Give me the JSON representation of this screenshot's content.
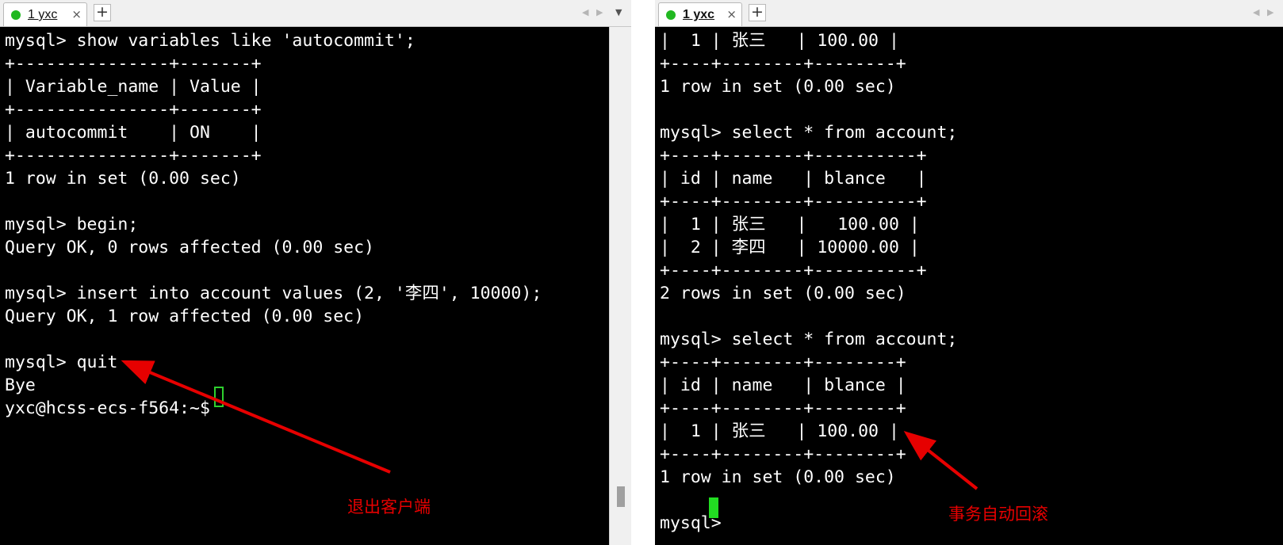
{
  "left_window": {
    "tab": {
      "title": "1 yxc",
      "close": "×"
    },
    "add_tab": "+",
    "nav": {
      "prev": "◀",
      "next": "▶",
      "menu": "▼"
    },
    "lines": [
      "mysql> show variables like 'autocommit';",
      "+---------------+-------+",
      "| Variable_name | Value |",
      "+---------------+-------+",
      "| autocommit    | ON    |",
      "+---------------+-------+",
      "1 row in set (0.00 sec)",
      "",
      "mysql> begin;",
      "Query OK, 0 rows affected (0.00 sec)",
      "",
      "mysql> insert into account values (2, '李四', 10000);",
      "Query OK, 1 row affected (0.00 sec)",
      "",
      "mysql> quit",
      "Bye",
      "yxc@hcss-ecs-f564:~$ "
    ],
    "annotation": "退出客户端"
  },
  "right_window": {
    "tab": {
      "title": "1 yxc",
      "close": "×"
    },
    "add_tab": "+",
    "nav": {
      "prev": "◀",
      "next": "▶"
    },
    "lines": [
      "|  1 | 张三   | 100.00 |",
      "+----+--------+--------+",
      "1 row in set (0.00 sec)",
      "",
      "mysql> select * from account;",
      "+----+--------+----------+",
      "| id | name   | blance   |",
      "+----+--------+----------+",
      "|  1 | 张三   |   100.00 |",
      "|  2 | 李四   | 10000.00 |",
      "+----+--------+----------+",
      "2 rows in set (0.00 sec)",
      "",
      "mysql> select * from account;",
      "+----+--------+--------+",
      "| id | name   | blance |",
      "+----+--------+--------+",
      "|  1 | 张三   | 100.00 |",
      "+----+--------+--------+",
      "1 row in set (0.00 sec)",
      "",
      "mysql> "
    ],
    "annotation": "事务自动回滚"
  },
  "colors": {
    "terminal_bg": "#000000",
    "terminal_fg": "#ffffff",
    "cursor": "#22dd22",
    "annotation": "#e60000",
    "status_dot": "#21b821"
  }
}
